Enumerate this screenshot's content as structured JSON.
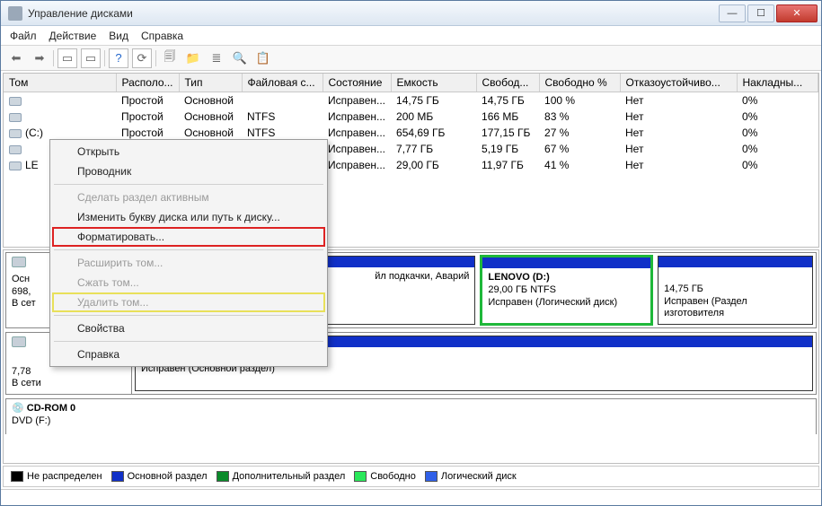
{
  "window": {
    "title": "Управление дисками"
  },
  "menubar": [
    "Файл",
    "Действие",
    "Вид",
    "Справка"
  ],
  "columns": [
    "Том",
    "Располо...",
    "Тип",
    "Файловая с...",
    "Состояние",
    "Емкость",
    "Свобод...",
    "Свободно %",
    "Отказоустойчиво...",
    "Накладны..."
  ],
  "rows": [
    {
      "vol": "",
      "layout": "Простой",
      "type": "Основной",
      "fs": "",
      "state": "Исправен...",
      "cap": "14,75 ГБ",
      "free": "14,75 ГБ",
      "pct": "100 %",
      "ft": "Нет",
      "oh": "0%"
    },
    {
      "vol": "",
      "layout": "Простой",
      "type": "Основной",
      "fs": "NTFS",
      "state": "Исправен...",
      "cap": "200 МБ",
      "free": "166 МБ",
      "pct": "83 %",
      "ft": "Нет",
      "oh": "0%"
    },
    {
      "vol": "(C:)",
      "layout": "Простой",
      "type": "Основной",
      "fs": "NTFS",
      "state": "Исправен...",
      "cap": "654,69 ГБ",
      "free": "177,15 ГБ",
      "pct": "27 %",
      "ft": "Нет",
      "oh": "0%"
    },
    {
      "vol": "",
      "layout": "",
      "type": "",
      "fs": "",
      "state": "Исправен...",
      "cap": "7,77 ГБ",
      "free": "5,19 ГБ",
      "pct": "67 %",
      "ft": "Нет",
      "oh": "0%"
    },
    {
      "vol": "LE",
      "layout": "",
      "type": "",
      "fs": "",
      "state": "Исправен...",
      "cap": "29,00 ГБ",
      "free": "11,97 ГБ",
      "pct": "41 %",
      "ft": "Нет",
      "oh": "0%"
    }
  ],
  "context_menu": {
    "open": "Открыть",
    "explorer": "Проводник",
    "make_active": "Сделать раздел активным",
    "change_letter": "Изменить букву диска или путь к диску...",
    "format": "Форматировать...",
    "extend": "Расширить том...",
    "shrink": "Сжать том...",
    "delete": "Удалить том...",
    "properties": "Свойства",
    "help": "Справка"
  },
  "disk0": {
    "left_line1": "Осн",
    "left_line2": "698,",
    "left_line3": "В сет",
    "part_swap": "йл подкачки, Аварий",
    "lenovo_title": "LENOVO  (D:)",
    "lenovo_size": "29,00 ГБ NTFS",
    "lenovo_state": "Исправен (Логический диск)",
    "oem_size": "14,75 ГБ",
    "oem_state": "Исправен (Раздел изготовителя"
  },
  "disk1": {
    "left_line2": "7,78",
    "left_line3": "В сети",
    "part_state": "Исправен (Основной раздел)"
  },
  "cdrom": {
    "title": "CD-ROM 0",
    "drive": "DVD (F:)"
  },
  "legend": {
    "unalloc": "Не распределен",
    "primary": "Основной раздел",
    "extended": "Дополнительный раздел",
    "free": "Свободно",
    "logical": "Логический диск"
  }
}
